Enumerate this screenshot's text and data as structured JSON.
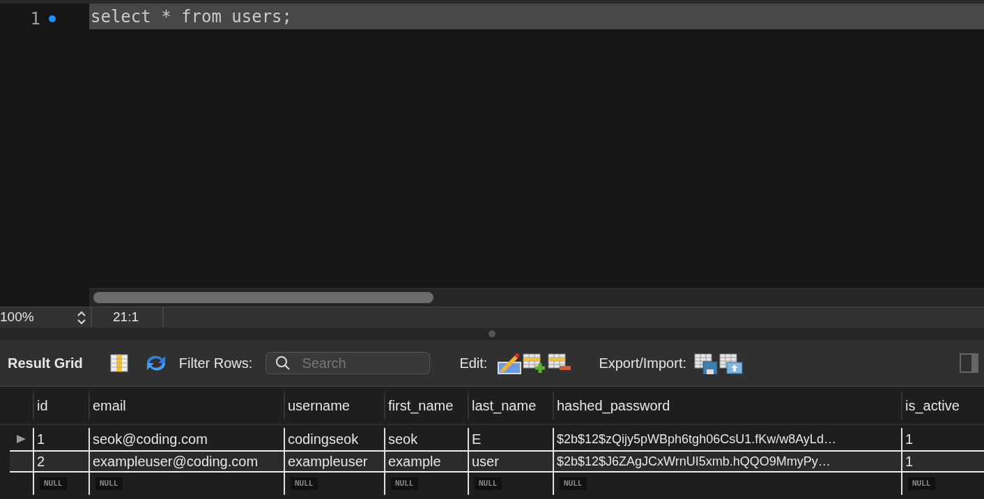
{
  "editor": {
    "lines": [
      {
        "number": "1",
        "marker": true,
        "current": true,
        "code": "select * from users;"
      }
    ]
  },
  "status_bar": {
    "zoom": "100%",
    "position": "21:1"
  },
  "toolbar": {
    "title": "Result Grid",
    "filter_label": "Filter Rows:",
    "search": {
      "placeholder": "Search"
    },
    "edit_label": "Edit:",
    "export_label": "Export/Import:"
  },
  "table": {
    "columns": [
      "id",
      "email",
      "username",
      "first_name",
      "last_name",
      "hashed_password",
      "is_active"
    ],
    "rows": [
      {
        "current": true,
        "selected": false,
        "kind": "data",
        "cells": [
          "1",
          "seok@coding.com",
          "codingseok",
          "seok",
          "E",
          "$2b$12$zQijy5pWBph6tgh06CsU1.fKw/w8AyLd…",
          "1"
        ]
      },
      {
        "current": false,
        "selected": true,
        "kind": "data",
        "cells": [
          "2",
          "exampleuser@coding.com",
          "exampleuser",
          "example",
          "user",
          "$2b$12$J6ZAgJCxWrnUI5xmb.hQQO9MmyPy…",
          "1"
        ]
      },
      {
        "current": false,
        "selected": false,
        "kind": "null",
        "cells": [
          "NULL",
          "NULL",
          "NULL",
          "NULL",
          "NULL",
          "NULL",
          "NULL"
        ]
      }
    ]
  }
}
